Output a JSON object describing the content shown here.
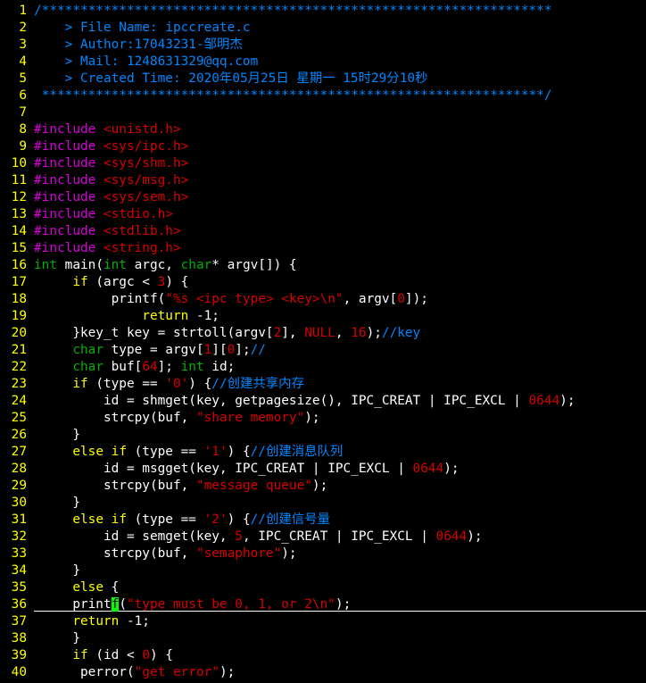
{
  "editor": {
    "colors": {
      "background": "#000000",
      "line_number": "#ffff00",
      "comment": "#0087ff",
      "preprocessor": "#d700d7",
      "string": "#d70000",
      "type": "#00af00",
      "keyword": "#ffff00",
      "text": "#ffffff",
      "cursor": "#00ff00"
    },
    "cursor": {
      "line": 36,
      "column_char": "f"
    },
    "lines": [
      {
        "n": "1",
        "segments": [
          {
            "t": "/******************************************************************",
            "c": "comment"
          }
        ]
      },
      {
        "n": "2",
        "segments": [
          {
            "t": "    > File Name: ipccreate.c",
            "c": "comment"
          }
        ]
      },
      {
        "n": "3",
        "segments": [
          {
            "t": "    > Author:17043231-邹明杰",
            "c": "comment"
          }
        ]
      },
      {
        "n": "4",
        "segments": [
          {
            "t": "    > Mail: 1248631329@qq.com",
            "c": "comment"
          }
        ]
      },
      {
        "n": "5",
        "segments": [
          {
            "t": "    > Created Time: 2020年05月25日 星期一 15时29分10秒",
            "c": "comment"
          }
        ]
      },
      {
        "n": "6",
        "segments": [
          {
            "t": " *****************************************************************/",
            "c": "comment"
          }
        ]
      },
      {
        "n": "7",
        "segments": []
      },
      {
        "n": "8",
        "segments": [
          {
            "t": "#include ",
            "c": "pre"
          },
          {
            "t": "<unistd.h>",
            "c": "str"
          }
        ]
      },
      {
        "n": "9",
        "segments": [
          {
            "t": "#include ",
            "c": "pre"
          },
          {
            "t": "<sys/ipc.h>",
            "c": "str"
          }
        ]
      },
      {
        "n": "10",
        "segments": [
          {
            "t": "#include ",
            "c": "pre"
          },
          {
            "t": "<sys/shm.h>",
            "c": "str"
          }
        ]
      },
      {
        "n": "11",
        "segments": [
          {
            "t": "#include ",
            "c": "pre"
          },
          {
            "t": "<sys/msg.h>",
            "c": "str"
          }
        ]
      },
      {
        "n": "12",
        "segments": [
          {
            "t": "#include ",
            "c": "pre"
          },
          {
            "t": "<sys/sem.h>",
            "c": "str"
          }
        ]
      },
      {
        "n": "13",
        "segments": [
          {
            "t": "#include ",
            "c": "pre"
          },
          {
            "t": "<stdio.h>",
            "c": "str"
          }
        ]
      },
      {
        "n": "14",
        "segments": [
          {
            "t": "#include ",
            "c": "pre"
          },
          {
            "t": "<stdlib.h>",
            "c": "str"
          }
        ]
      },
      {
        "n": "15",
        "segments": [
          {
            "t": "#include ",
            "c": "pre"
          },
          {
            "t": "<string.h>",
            "c": "str"
          }
        ]
      },
      {
        "n": "16",
        "segments": [
          {
            "t": "int",
            "c": "type"
          },
          {
            "t": " main(",
            "c": "plain"
          },
          {
            "t": "int",
            "c": "type"
          },
          {
            "t": " argc, ",
            "c": "plain"
          },
          {
            "t": "char",
            "c": "type"
          },
          {
            "t": "* argv[]) {",
            "c": "plain"
          }
        ]
      },
      {
        "n": "17",
        "segments": [
          {
            "t": "     ",
            "c": "plain"
          },
          {
            "t": "if",
            "c": "kw"
          },
          {
            "t": " (argc < ",
            "c": "plain"
          },
          {
            "t": "3",
            "c": "str"
          },
          {
            "t": ") {",
            "c": "plain"
          }
        ]
      },
      {
        "n": "18",
        "segments": [
          {
            "t": "          printf(",
            "c": "plain"
          },
          {
            "t": "\"%s <ipc type> <key>\\n\"",
            "c": "str"
          },
          {
            "t": ", argv[",
            "c": "plain"
          },
          {
            "t": "0",
            "c": "str"
          },
          {
            "t": "]);",
            "c": "plain"
          }
        ]
      },
      {
        "n": "19",
        "segments": [
          {
            "t": "              ",
            "c": "plain"
          },
          {
            "t": "return",
            "c": "kw"
          },
          {
            "t": " -1;",
            "c": "plain"
          }
        ]
      },
      {
        "n": "20",
        "segments": [
          {
            "t": "     }key_t key = strtoll(argv[",
            "c": "plain"
          },
          {
            "t": "2",
            "c": "str"
          },
          {
            "t": "], ",
            "c": "plain"
          },
          {
            "t": "NULL",
            "c": "str"
          },
          {
            "t": ", ",
            "c": "plain"
          },
          {
            "t": "16",
            "c": "str"
          },
          {
            "t": ");",
            "c": "plain"
          },
          {
            "t": "//key",
            "c": "comment"
          }
        ]
      },
      {
        "n": "21",
        "segments": [
          {
            "t": "     ",
            "c": "plain"
          },
          {
            "t": "char",
            "c": "type"
          },
          {
            "t": " type = argv[",
            "c": "plain"
          },
          {
            "t": "1",
            "c": "str"
          },
          {
            "t": "][",
            "c": "plain"
          },
          {
            "t": "0",
            "c": "str"
          },
          {
            "t": "];",
            "c": "plain"
          },
          {
            "t": "//",
            "c": "comment"
          }
        ]
      },
      {
        "n": "22",
        "segments": [
          {
            "t": "     ",
            "c": "plain"
          },
          {
            "t": "char",
            "c": "type"
          },
          {
            "t": " buf[",
            "c": "plain"
          },
          {
            "t": "64",
            "c": "str"
          },
          {
            "t": "]; ",
            "c": "plain"
          },
          {
            "t": "int",
            "c": "type"
          },
          {
            "t": " id;",
            "c": "plain"
          }
        ]
      },
      {
        "n": "23",
        "segments": [
          {
            "t": "     ",
            "c": "plain"
          },
          {
            "t": "if",
            "c": "kw"
          },
          {
            "t": " (type == ",
            "c": "plain"
          },
          {
            "t": "'0'",
            "c": "str"
          },
          {
            "t": ") {",
            "c": "plain"
          },
          {
            "t": "//创建共享内存",
            "c": "comment"
          }
        ]
      },
      {
        "n": "24",
        "segments": [
          {
            "t": "         id = shmget(key, getpagesize(), IPC_CREAT | IPC_EXCL | ",
            "c": "plain"
          },
          {
            "t": "0644",
            "c": "str"
          },
          {
            "t": ");",
            "c": "plain"
          }
        ]
      },
      {
        "n": "25",
        "segments": [
          {
            "t": "         strcpy(buf, ",
            "c": "plain"
          },
          {
            "t": "\"share memory\"",
            "c": "str"
          },
          {
            "t": ");",
            "c": "plain"
          }
        ]
      },
      {
        "n": "26",
        "segments": [
          {
            "t": "     }",
            "c": "plain"
          }
        ]
      },
      {
        "n": "27",
        "segments": [
          {
            "t": "     ",
            "c": "plain"
          },
          {
            "t": "else",
            "c": "kw"
          },
          {
            "t": " ",
            "c": "plain"
          },
          {
            "t": "if",
            "c": "kw"
          },
          {
            "t": " (type == ",
            "c": "plain"
          },
          {
            "t": "'1'",
            "c": "str"
          },
          {
            "t": ") {",
            "c": "plain"
          },
          {
            "t": "//创建消息队列",
            "c": "comment"
          }
        ]
      },
      {
        "n": "28",
        "segments": [
          {
            "t": "         id = msgget(key, IPC_CREAT | IPC_EXCL | ",
            "c": "plain"
          },
          {
            "t": "0644",
            "c": "str"
          },
          {
            "t": ");",
            "c": "plain"
          }
        ]
      },
      {
        "n": "29",
        "segments": [
          {
            "t": "         strcpy(buf, ",
            "c": "plain"
          },
          {
            "t": "\"message queue\"",
            "c": "str"
          },
          {
            "t": ");",
            "c": "plain"
          }
        ]
      },
      {
        "n": "30",
        "segments": [
          {
            "t": "     }",
            "c": "plain"
          }
        ]
      },
      {
        "n": "31",
        "segments": [
          {
            "t": "     ",
            "c": "plain"
          },
          {
            "t": "else",
            "c": "kw"
          },
          {
            "t": " ",
            "c": "plain"
          },
          {
            "t": "if",
            "c": "kw"
          },
          {
            "t": " (type == ",
            "c": "plain"
          },
          {
            "t": "'2'",
            "c": "str"
          },
          {
            "t": ") {",
            "c": "plain"
          },
          {
            "t": "//创建信号量",
            "c": "comment"
          }
        ]
      },
      {
        "n": "32",
        "segments": [
          {
            "t": "         id = semget(key, ",
            "c": "plain"
          },
          {
            "t": "5",
            "c": "str"
          },
          {
            "t": ", IPC_CREAT | IPC_EXCL | ",
            "c": "plain"
          },
          {
            "t": "0644",
            "c": "str"
          },
          {
            "t": ");",
            "c": "plain"
          }
        ]
      },
      {
        "n": "33",
        "segments": [
          {
            "t": "         strcpy(buf, ",
            "c": "plain"
          },
          {
            "t": "\"semaphore\"",
            "c": "str"
          },
          {
            "t": ");",
            "c": "plain"
          }
        ]
      },
      {
        "n": "34",
        "segments": [
          {
            "t": "     }",
            "c": "plain"
          }
        ]
      },
      {
        "n": "35",
        "segments": [
          {
            "t": "     ",
            "c": "plain"
          },
          {
            "t": "else",
            "c": "kw"
          },
          {
            "t": " {",
            "c": "plain"
          }
        ]
      },
      {
        "n": "36",
        "segments": [
          {
            "t": "     print",
            "c": "plain"
          },
          {
            "t": "f",
            "c": "cursor"
          },
          {
            "t": "(",
            "c": "plain"
          },
          {
            "t": "\"type must be 0, 1, or 2\\n\"",
            "c": "str"
          },
          {
            "t": ");",
            "c": "plain"
          }
        ]
      },
      {
        "n": "37",
        "segments": [
          {
            "t": "     ",
            "c": "plain"
          },
          {
            "t": "return",
            "c": "kw"
          },
          {
            "t": " -1;",
            "c": "plain"
          }
        ]
      },
      {
        "n": "38",
        "segments": [
          {
            "t": "     }",
            "c": "plain"
          }
        ]
      },
      {
        "n": "39",
        "segments": [
          {
            "t": "     ",
            "c": "plain"
          },
          {
            "t": "if",
            "c": "kw"
          },
          {
            "t": " (id < ",
            "c": "plain"
          },
          {
            "t": "0",
            "c": "str"
          },
          {
            "t": ") {",
            "c": "plain"
          }
        ]
      },
      {
        "n": "40",
        "segments": [
          {
            "t": "      perror(",
            "c": "plain"
          },
          {
            "t": "\"get error\"",
            "c": "str"
          },
          {
            "t": ");",
            "c": "plain"
          }
        ]
      }
    ]
  }
}
